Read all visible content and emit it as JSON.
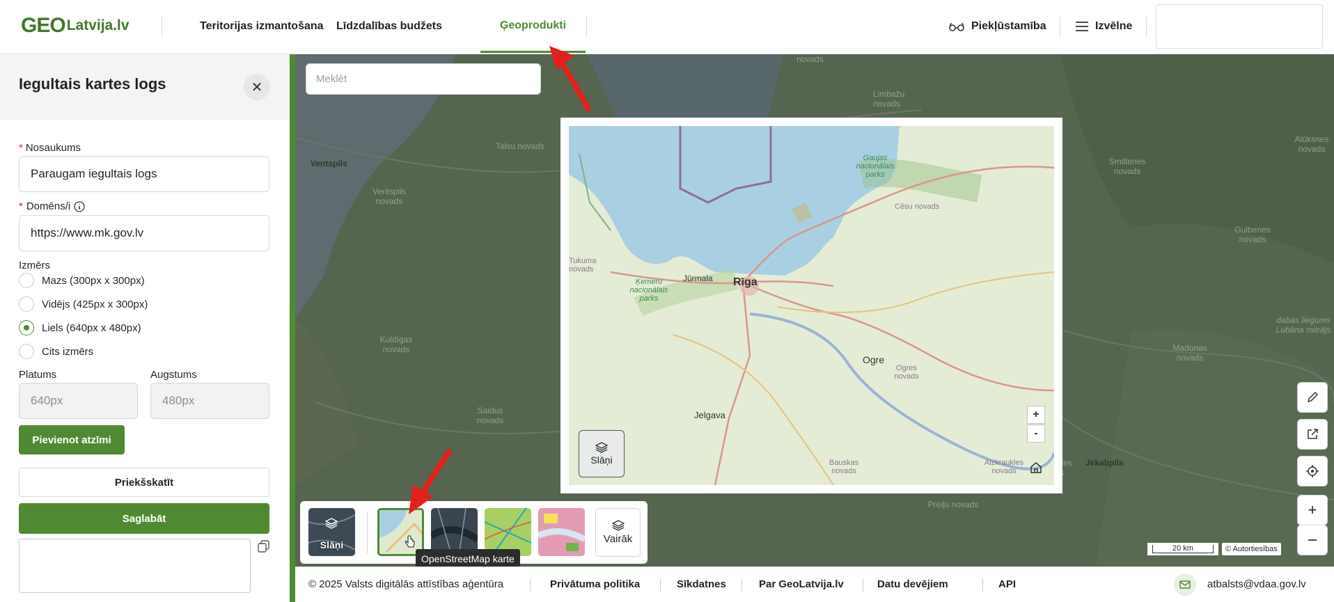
{
  "header": {
    "logo": {
      "geo": "GEO",
      "lv": "Latvija.lv"
    },
    "nav": [
      "Teritorijas izmantošana",
      "Līdzdalības budžets",
      "Ģeoprodukti"
    ],
    "accessibility_label": "Piekļūstamība",
    "menu_label": "Izvēlne"
  },
  "panel": {
    "title": "Iegultais kartes logs",
    "name_label": "Nosaukums",
    "name_value": "Paraugam iegultais logs",
    "domain_label": "Domēns/i",
    "domain_value": "https://www.mk.gov.lv",
    "size_label": "Izmērs",
    "size_options": [
      "Mazs (300px x 300px)",
      "Vidējs (425px x 300px)",
      "Liels (640px x 480px)",
      "Cits izmērs"
    ],
    "selected_size": "Liels (640px x 480px)",
    "width_label": "Platums",
    "width_placeholder": "640px",
    "height_label": "Augstums",
    "height_placeholder": "480px",
    "add_marker": "Pievienot atzīmi",
    "preview": "Priekšskatīt",
    "save": "Saglabāt"
  },
  "map": {
    "search_placeholder": "Meklēt",
    "labels_bg": [
      "Ventspils",
      "Ventspils novads",
      "Talsu novads",
      "Limbažu novads",
      "Kuldīgas novads",
      "Saldus novads",
      "Alūksnes novads",
      "Smiltenes novads",
      "Gulbenes novads",
      "Madonas novads",
      "Jēkabpils",
      "dabas liegums Lubāna mitrājs",
      "Aizkraukles novads",
      "Preiļu novads",
      "novads"
    ],
    "embed_labels": [
      "Gaujas nacionālais parks",
      "Cēsu novads",
      "Tukuma novads",
      "Ķemeru nacionālais parks",
      "Jūrmala",
      "Rīga",
      "Ogre",
      "Ogres novads",
      "Jelgava",
      "Bauskas novads",
      "Aizkraukles novads"
    ],
    "layers_label": "Slāņi",
    "zoom_in": "+",
    "zoom_out": "-",
    "basemaps": {
      "layers": "Slāņi",
      "more": "Vairāk"
    },
    "tooltip": "OpenStreetMap karte",
    "scale": "20 km",
    "attribution": "© Autortiesības"
  },
  "footer": {
    "copyright": "© 2025 Valsts digitālās attīstības aģentūra",
    "links": [
      "Privātuma politika",
      "Sīkdatnes",
      "Par GeoLatvija.lv",
      "Datu devējiem",
      "API"
    ],
    "email": "atbalsts@vdaa.gov.lv"
  },
  "colors": {
    "accent": "#4f8a33",
    "required": "#c0392b",
    "logo_ring": "#c43a2e"
  }
}
